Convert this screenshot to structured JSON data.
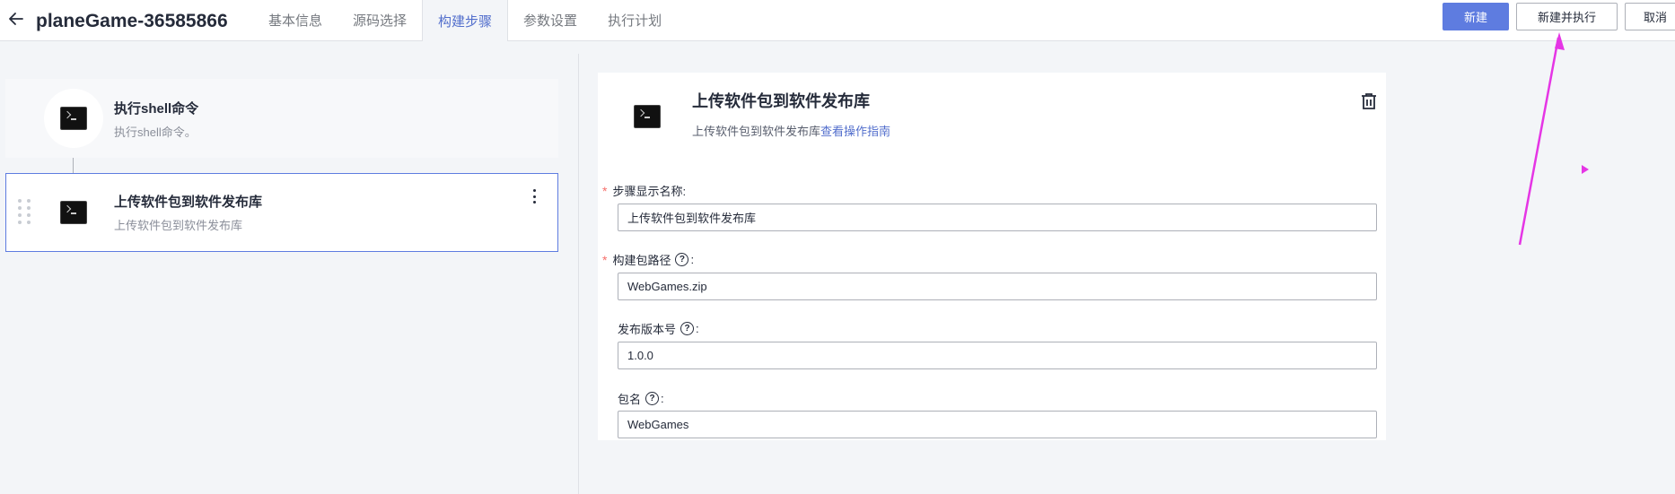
{
  "header": {
    "title": "planeGame-36585866",
    "tabs": [
      {
        "label": "基本信息",
        "active": false
      },
      {
        "label": "源码选择",
        "active": false
      },
      {
        "label": "构建步骤",
        "active": true
      },
      {
        "label": "参数设置",
        "active": false
      },
      {
        "label": "执行计划",
        "active": false
      }
    ],
    "buttons": {
      "new": "新建",
      "new_and_run": "新建并执行",
      "cancel": "取消"
    }
  },
  "steps": [
    {
      "name": "执行shell命令",
      "desc": "执行shell命令。",
      "icon": "terminal-icon",
      "selected": false
    },
    {
      "name": "上传软件包到软件发布库",
      "desc": "上传软件包到软件发布库",
      "icon": "terminal-icon",
      "selected": true
    }
  ],
  "form": {
    "title": "上传软件包到软件发布库",
    "subtitle": "上传软件包到软件发布库",
    "guide_link": "查看操作指南",
    "fields": [
      {
        "label": "步骤显示名称:",
        "required": true,
        "help": false,
        "value": "上传软件包到软件发布库"
      },
      {
        "label": "构建包路径",
        "required": true,
        "help": true,
        "value": "WebGames.zip"
      },
      {
        "label": "发布版本号",
        "required": false,
        "help": true,
        "value": "1.0.0"
      },
      {
        "label": "包名",
        "required": false,
        "help": true,
        "value": "WebGames"
      }
    ]
  },
  "colors": {
    "primary": "#5e7ce0",
    "link": "#526ecc",
    "required": "#f66f6a",
    "annotation": "#e535e5"
  }
}
